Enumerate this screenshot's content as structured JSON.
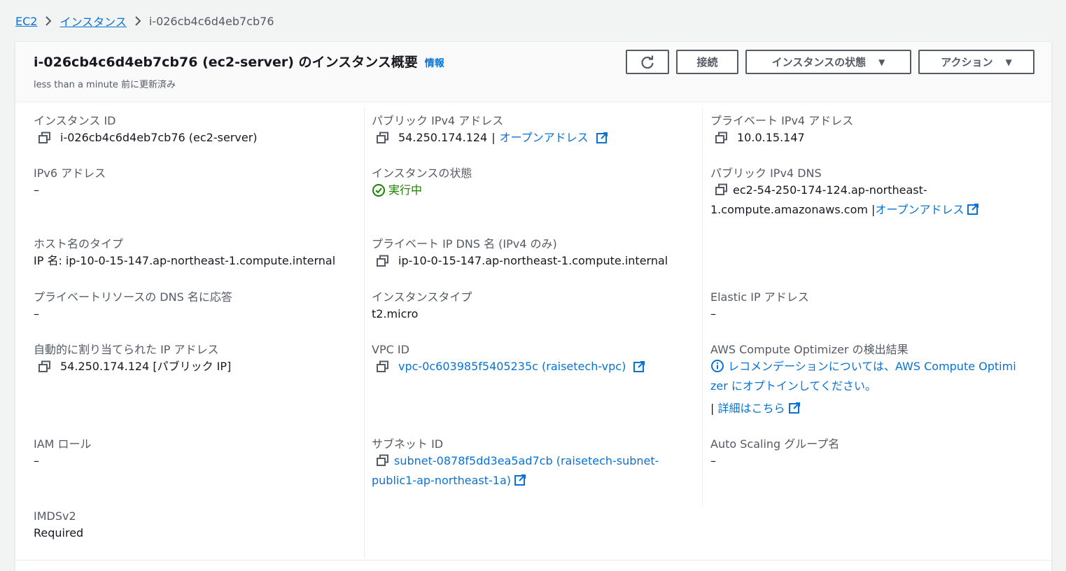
{
  "breadcrumb": {
    "ec2": "EC2",
    "instances": "インスタンス",
    "current": "i-026cb4c6d4eb7cb76"
  },
  "header": {
    "title": "i-026cb4c6d4eb7cb76 (ec2-server) のインスタンス概要",
    "info": "情報",
    "updated": "less than a minute 前に更新済み",
    "connect": "接続",
    "instance_state": "インスタンスの状態",
    "actions": "アクション"
  },
  "fields": {
    "instance_id": {
      "label": "インスタンス ID",
      "value": "i-026cb4c6d4eb7cb76 (ec2-server)"
    },
    "public_ipv4": {
      "label": "パブリック IPv4 アドレス",
      "value": "54.250.174.124",
      "link": "オープンアドレス"
    },
    "private_ipv4": {
      "label": "プライベート IPv4 アドレス",
      "value": "10.0.15.147"
    },
    "ipv6": {
      "label": "IPv6 アドレス",
      "value": "–"
    },
    "instance_state": {
      "label": "インスタンスの状態",
      "value": "実行中"
    },
    "public_dns": {
      "label": "パブリック IPv4 DNS",
      "value_line1": "ec2-54-250-174-124.ap-northeast-",
      "value_line2": "1.compute.amazonaws.com",
      "link": "オープンアドレス"
    },
    "hostname_type": {
      "label": "ホスト名のタイプ",
      "value": "IP 名: ip-10-0-15-147.ap-northeast-1.compute.internal"
    },
    "private_dns": {
      "label": "プライベート IP DNS 名 (IPv4 のみ)",
      "value": "ip-10-0-15-147.ap-northeast-1.compute.internal"
    },
    "resource_dns": {
      "label": "プライベートリソースの DNS 名に応答",
      "value": "–"
    },
    "instance_type": {
      "label": "インスタンスタイプ",
      "value": "t2.micro"
    },
    "elastic_ip": {
      "label": "Elastic IP アドレス",
      "value": "–"
    },
    "auto_ip": {
      "label": "自動的に割り当てられた IP アドレス",
      "value": "54.250.174.124 [パブリック IP]"
    },
    "vpc_id": {
      "label": "VPC ID",
      "value": "vpc-0c603985f5405235c (raisetech-vpc)"
    },
    "optimizer": {
      "label": "AWS Compute Optimizer の検出結果",
      "line1": "レコメンデーションについては、AWS Compute Optimi",
      "line2": "zer にオプトインしてください。",
      "details": "詳細はこちら"
    },
    "iam_role": {
      "label": "IAM ロール",
      "value": "–"
    },
    "subnet_id": {
      "label": "サブネット ID",
      "value_line1": "subnet-0878f5dd3ea5ad7cb (raisetech-subnet-",
      "value_line2": "public1-ap-northeast-1a)"
    },
    "asg_name": {
      "label": "Auto Scaling グループ名",
      "value": "–"
    },
    "imdsv2": {
      "label": "IMDSv2",
      "value": "Required"
    }
  },
  "colors": {
    "link": "#0972d3",
    "success": "#1d8102",
    "label": "#545b64",
    "background": "#f2f3f3"
  }
}
